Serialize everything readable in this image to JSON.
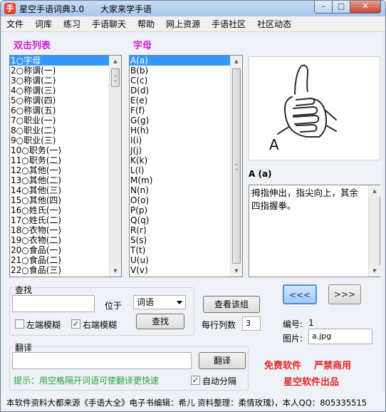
{
  "window": {
    "title": "星空手语词典3.0      大家来学手语",
    "icon_letter": "手",
    "min_label": "–",
    "max_label": "□",
    "close_label": "✕"
  },
  "menu": [
    "文件",
    "词库",
    "练习",
    "手语聊天",
    "帮助",
    "网上资源",
    "手语社区",
    "社区动态"
  ],
  "left_header": "双击列表",
  "right_header": "字母",
  "category_list": [
    "1○字母",
    "2○称谓(一)",
    "3○称谓(二)",
    "4○称谓(三)",
    "5○称谓(四)",
    "6○称谓(五)",
    "7○职业(一)",
    "8○职业(二)",
    "9○职业(三)",
    "10○职务(一)",
    "11○职务(二)",
    "12○其他(一)",
    "13○其他(二)",
    "14○其他(三)",
    "15○其他(四)",
    "16○姓氏(一)",
    "17○姓氏(二)",
    "18○衣物(一)",
    "19○衣物(二)",
    "20○食品(一)",
    "21○食品(二)",
    "22○食品(三)"
  ],
  "letter_list": [
    "A(a)",
    "B(b)",
    "C(c)",
    "D(d)",
    "E(e)",
    "F(f)",
    "G(g)",
    "H(h)",
    "I(i)",
    "J(j)",
    "K(k)",
    "L(l)",
    "M(m)",
    "N(n)",
    "O(o)",
    "P(p)",
    "Q(q)",
    "R(r)",
    "S(s)",
    "T(t)",
    "U(u)",
    "V(v)"
  ],
  "sign_image": {
    "letter": "A",
    "icon": "thumbs-up-fist-hand"
  },
  "caption": "A (a)",
  "description": "拇指伸出，指尖向上，其余四指握拳。",
  "search": {
    "group_label": "查找",
    "position_label": "位于",
    "mode_value": "词语",
    "find_button": "查找",
    "left_fuzzy_label": "左端模糊",
    "left_fuzzy_checked": false,
    "right_fuzzy_label": "右端模糊",
    "right_fuzzy_checked": true,
    "input_value": ""
  },
  "view": {
    "view_group_button": "查看该组",
    "per_row_label": "每行列数",
    "per_row_value": "3"
  },
  "nav": {
    "prev": "<<<",
    "next": ">>>"
  },
  "info": {
    "number_label": "编号:",
    "number_value": "1",
    "picture_label": "图片:",
    "picture_value": "a.jpg"
  },
  "translate": {
    "group_label": "翻译",
    "button": "翻译",
    "hint": "提示：用空格隔开词语可使翻译更快速",
    "auto_split_label": "自动分隔",
    "auto_split_checked": true,
    "input_value": ""
  },
  "promo": {
    "line1": "免费软件    严禁商用",
    "line2": "星空软件出品"
  },
  "status": "本软件资料大都来源《手语大全》电子书编辑：希儿 资料整理：柔情玫瑰)，本人QQ：805335515",
  "colors": {
    "header": "#d01fd3",
    "selection": "#3399ff",
    "promo": "#e52828",
    "hint": "#27a43a"
  }
}
